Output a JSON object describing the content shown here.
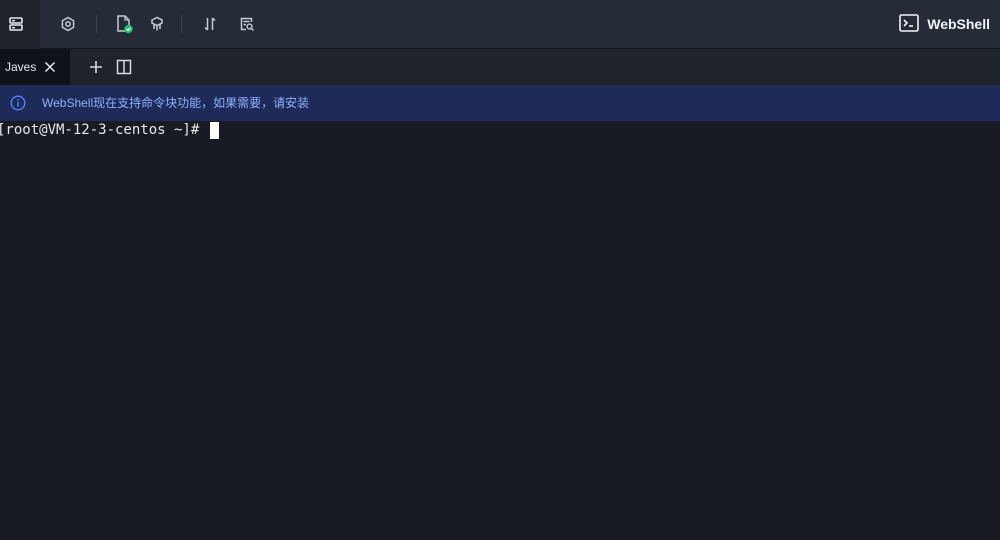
{
  "toolbar": {
    "icons": [
      {
        "name": "server-list-icon"
      },
      {
        "name": "settings-icon"
      },
      {
        "name": "file-upload-icon"
      },
      {
        "name": "brush-icon"
      },
      {
        "name": "transfer-icon"
      },
      {
        "name": "file-search-icon"
      }
    ],
    "brand": {
      "icon": "terminal-icon",
      "label": "WebShell"
    },
    "accent_color": "#1fbf6a"
  },
  "tabs": [
    {
      "label": "Javes",
      "active": true
    }
  ],
  "tabbar_actions": [
    {
      "name": "add-tab-icon"
    },
    {
      "name": "split-view-icon"
    }
  ],
  "notice": {
    "icon": "info-icon",
    "text": "WebShell现在支持命令块功能，如果需要，请安装",
    "color": "#8eb0ff",
    "background": "#1e2a57"
  },
  "terminal": {
    "prompt": "[root@VM-12-3-centos ~]# "
  }
}
